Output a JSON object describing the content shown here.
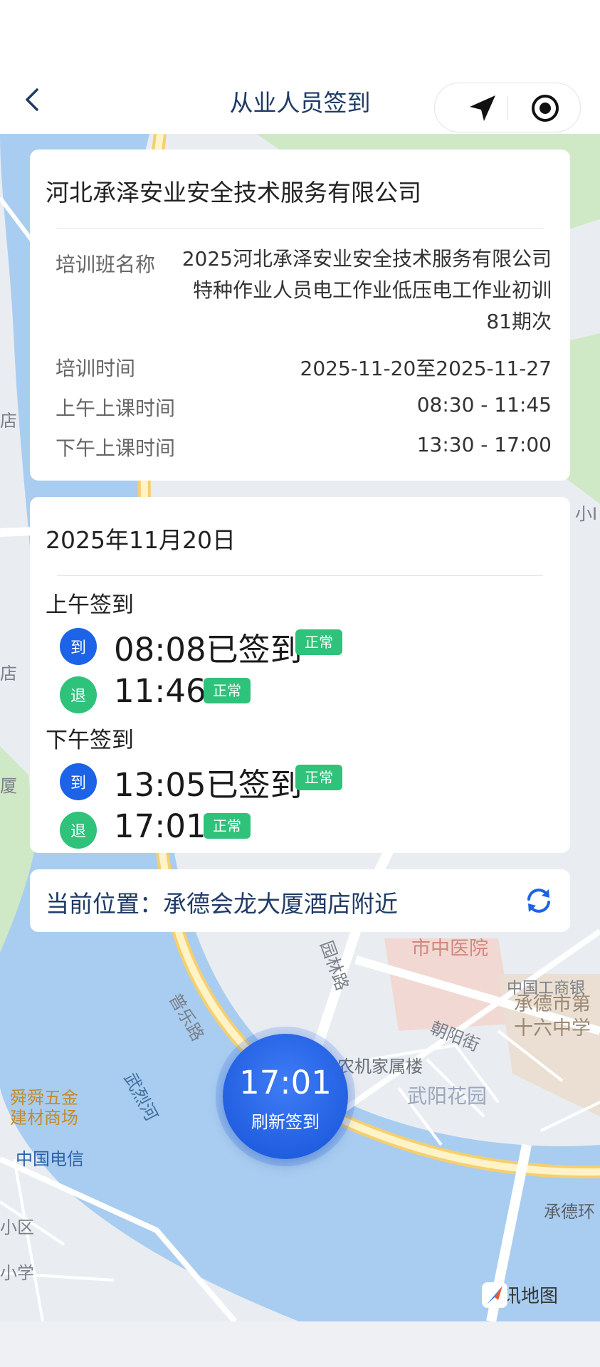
{
  "nav": {
    "title": "从业人员签到",
    "back_icon": "chevron-left-icon",
    "location_icon": "navigation-arrow-icon",
    "record_icon": "target-circle-icon"
  },
  "company": {
    "name": "河北承泽安业安全技术服务有限公司",
    "rows": [
      {
        "label": "培训班名称",
        "value": "2025河北承泽安业安全技术服务有限公司特种作业人员电工作业低压电工作业初训81期次"
      },
      {
        "label": "培训时间",
        "value": "2025-11-20至2025-11-27"
      },
      {
        "label": "上午上课时间",
        "value": "08:30 - 11:45"
      },
      {
        "label": "下午上课时间",
        "value": "13:30 - 17:00"
      }
    ]
  },
  "attendance": {
    "date": "2025年11月20日",
    "morning": {
      "title": "上午签到",
      "in": {
        "badge": "到",
        "text": "08:08已签到",
        "status": "正常"
      },
      "out": {
        "badge": "退",
        "text": "11:46",
        "status": "正常"
      }
    },
    "afternoon": {
      "title": "下午签到",
      "in": {
        "badge": "到",
        "text": "13:05已签到",
        "status": "正常"
      },
      "out": {
        "badge": "退",
        "text": "17:01",
        "status": "正常"
      }
    }
  },
  "location": {
    "text": "当前位置：承德会龙大厦酒店附近",
    "refresh_icon": "refresh-icon"
  },
  "sign_button": {
    "time": "17:01",
    "label": "刷新签到"
  },
  "map": {
    "labels": [
      "市中医院",
      "承德市第",
      "十六中学",
      "朝阳街",
      "园林路",
      "普乐路",
      "武烈河",
      "农机家属楼",
      "武阳花园",
      "舜舜五金",
      "建材商场",
      "中国电信",
      "承德环",
      "中国工商银",
      "小区",
      "小学",
      "店",
      "店",
      "厦",
      "小I"
    ],
    "logo": "腾讯地图"
  },
  "colors": {
    "primary": "#1c63e8",
    "success": "#2fc27a",
    "nav_title": "#1f3b66",
    "river": "#a9cdf0",
    "road": "#f6cf6d"
  }
}
